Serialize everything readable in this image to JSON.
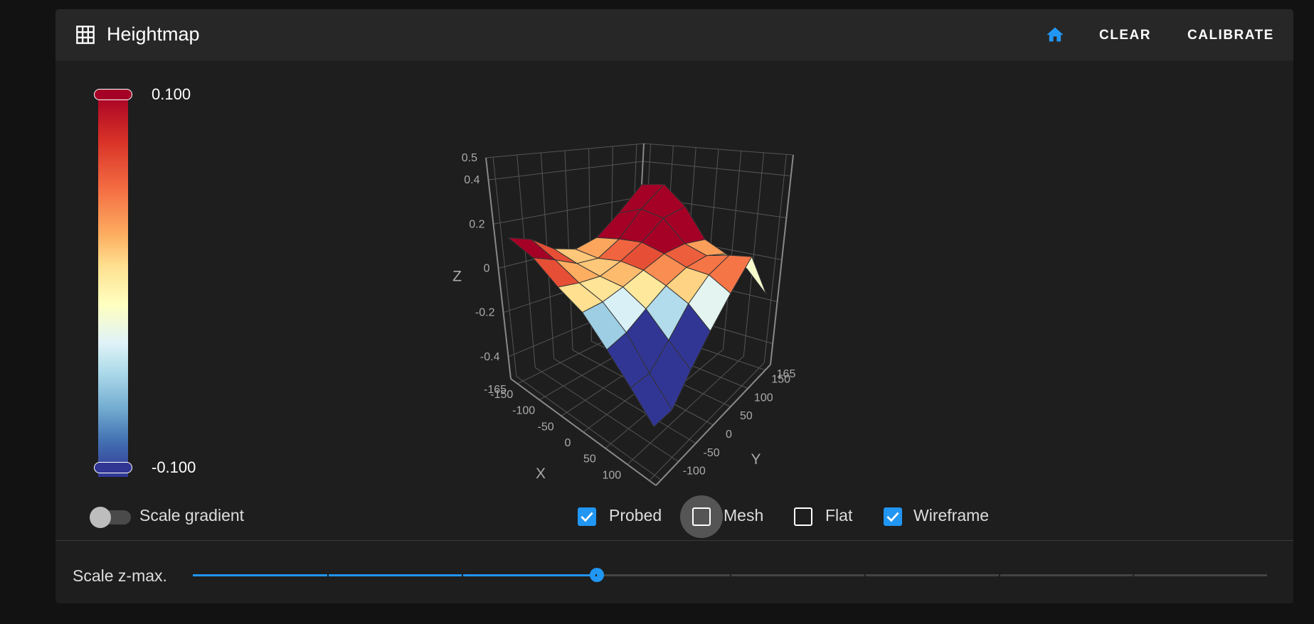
{
  "header": {
    "title": "Heightmap",
    "clear_label": "CLEAR",
    "calibrate_label": "CALIBRATE"
  },
  "gradient": {
    "max_label": "0.100",
    "min_label": "-0.100"
  },
  "controls": {
    "scale_gradient_label": "Scale gradient",
    "scale_gradient_on": false,
    "checkboxes": [
      {
        "label": "Probed",
        "checked": true
      },
      {
        "label": "Mesh",
        "checked": false
      },
      {
        "label": "Flat",
        "checked": false
      },
      {
        "label": "Wireframe",
        "checked": true
      }
    ]
  },
  "zmax": {
    "label": "Scale z-max.",
    "value_fraction": 0.376,
    "steps": 8
  },
  "colors": {
    "accent": "#2196f3",
    "bg": "#1e1e1e"
  },
  "chart_data": {
    "type": "surface",
    "xlabel": "X",
    "ylabel": "Y",
    "zlabel": "Z",
    "xrange": [
      -165,
      165
    ],
    "yrange": [
      -165,
      165
    ],
    "zrange": [
      -0.5,
      0.5
    ],
    "color_range": [
      -0.1,
      0.1
    ],
    "x_ticks": [
      "-165",
      "-150",
      "-100",
      "-50",
      "0",
      "50",
      "100"
    ],
    "y_ticks": [
      "-100",
      "-50",
      "0",
      "50",
      "100",
      "150",
      "165"
    ],
    "z_ticks": [
      "0.5",
      "0.4",
      "0.2",
      "0",
      "-0.2",
      "-0.4"
    ],
    "x": [
      -150,
      -100,
      -50,
      0,
      50,
      100,
      150
    ],
    "y": [
      -150,
      -100,
      -50,
      0,
      50,
      100,
      150
    ],
    "z": [
      [
        0.15,
        0.12,
        0.05,
        0.02,
        0.05,
        0.15,
        0.28
      ],
      [
        0.12,
        0.08,
        0.03,
        0.02,
        0.08,
        0.2,
        0.3
      ],
      [
        0.05,
        0.03,
        0.02,
        0.05,
        0.1,
        0.18,
        0.2
      ],
      [
        0.0,
        0.0,
        0.02,
        0.05,
        0.08,
        0.08,
        0.05
      ],
      [
        -0.1,
        -0.08,
        -0.03,
        0.02,
        0.05,
        0.05,
        0.0
      ],
      [
        -0.2,
        -0.2,
        -0.12,
        -0.02,
        0.05,
        0.08,
        -0.05
      ],
      [
        -0.3,
        -0.3,
        -0.2,
        -0.1,
        0.0,
        0.1,
        -0.15
      ]
    ]
  }
}
